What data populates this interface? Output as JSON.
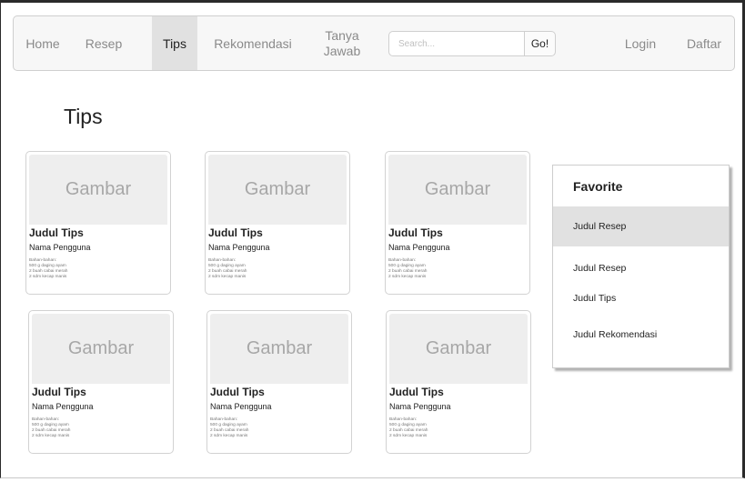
{
  "nav": {
    "items": [
      {
        "label": "Home",
        "active": false
      },
      {
        "label": "Resep",
        "active": false
      },
      {
        "label": "Tips",
        "active": true
      },
      {
        "label": "Rekomendasi",
        "active": false
      },
      {
        "label": "Tanya\nJawab",
        "active": false
      }
    ],
    "search_placeholder": "Search...",
    "go_label": "Go!",
    "login_label": "Login",
    "daftar_label": "Daftar"
  },
  "page": {
    "title": "Tips"
  },
  "cards": [
    {
      "image_label": "Gambar",
      "title": "Judul Tips",
      "user": "Nama Pengguna",
      "desc": "Bahan-bahan:\n500 g daging ayam\n2 buah cabai merah\n2 sdm kecap manis"
    },
    {
      "image_label": "Gambar",
      "title": "Judul Tips",
      "user": "Nama Pengguna",
      "desc": "Bahan-bahan:\n500 g daging ayam\n2 buah cabai merah\n2 sdm kecap manis"
    },
    {
      "image_label": "Gambar",
      "title": "Judul Tips",
      "user": "Nama Pengguna",
      "desc": "Bahan-bahan:\n500 g daging ayam\n2 buah cabai merah\n2 sdm kecap manis"
    },
    {
      "image_label": "Gambar",
      "title": "Judul Tips",
      "user": "Nama Pengguna",
      "desc": "Bahan-bahan:\n500 g daging ayam\n2 buah cabai merah\n2 sdm kecap manis"
    },
    {
      "image_label": "Gambar",
      "title": "Judul Tips",
      "user": "Nama Pengguna",
      "desc": "Bahan-bahan:\n500 g daging ayam\n2 buah cabai merah\n2 sdm kecap manis"
    },
    {
      "image_label": "Gambar",
      "title": "Judul Tips",
      "user": "Nama Pengguna",
      "desc": "Bahan-bahan:\n500 g daging ayam\n2 buah cabai merah\n2 sdm kecap manis"
    }
  ],
  "favorite": {
    "title": "Favorite",
    "items": [
      {
        "label": "Judul Resep",
        "active": true
      },
      {
        "label": "Judul Resep",
        "active": false
      },
      {
        "label": "Judul Tips",
        "active": false
      },
      {
        "label": "Judul Rekomendasi",
        "active": false
      }
    ]
  }
}
